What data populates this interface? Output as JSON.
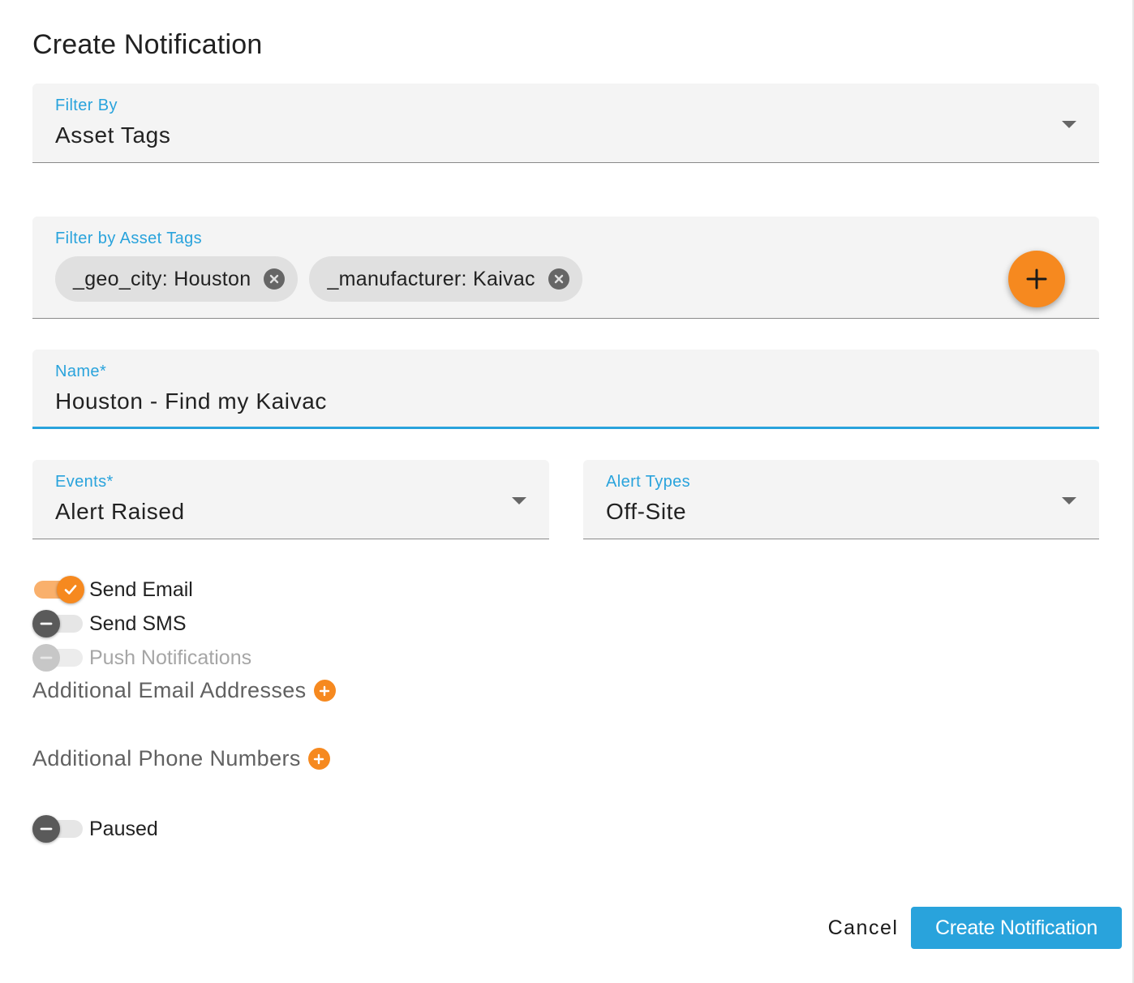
{
  "dialog": {
    "title": "Create Notification"
  },
  "filter_by": {
    "label": "Filter By",
    "value": "Asset Tags"
  },
  "asset_tags": {
    "label": "Filter by Asset Tags",
    "chips": [
      {
        "label": "_geo_city: Houston"
      },
      {
        "label": "_manufacturer: Kaivac"
      }
    ]
  },
  "name": {
    "label": "Name*",
    "value": "Houston - Find my Kaivac"
  },
  "events": {
    "label": "Events*",
    "value": "Alert Raised"
  },
  "alert_types": {
    "label": "Alert Types",
    "value": "Off-Site"
  },
  "toggles": {
    "send_email": {
      "label": "Send Email",
      "state": "on"
    },
    "send_sms": {
      "label": "Send SMS",
      "state": "off"
    },
    "push": {
      "label": "Push Notifications",
      "state": "disabled"
    },
    "paused": {
      "label": "Paused",
      "state": "off"
    }
  },
  "additional": {
    "emails_label": "Additional Email Addresses",
    "phones_label": "Additional Phone Numbers"
  },
  "actions": {
    "cancel_label": "Cancel",
    "create_label": "Create Notification"
  },
  "colors": {
    "accent": "#29a3dc",
    "orange": "#f6891f",
    "field_bg": "#f4f4f4"
  }
}
